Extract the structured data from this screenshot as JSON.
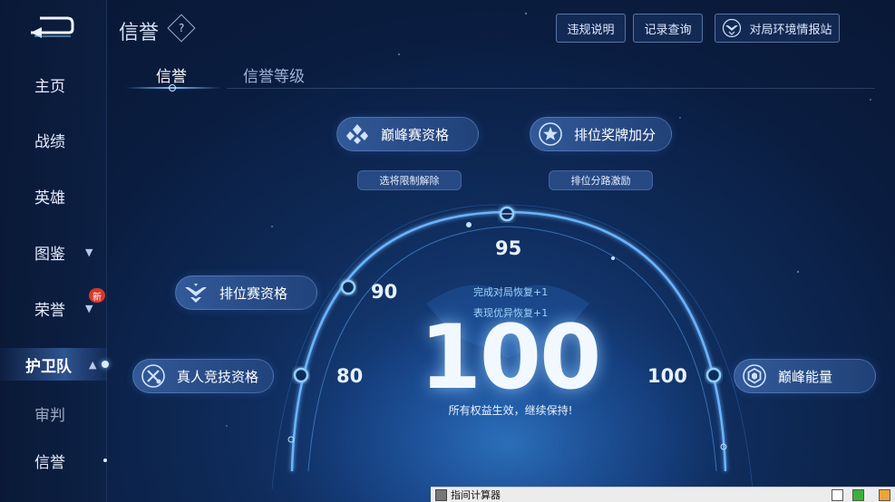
{
  "header": {
    "title": "信誉",
    "help_glyph": "?",
    "buttons": {
      "violation": "违规说明",
      "records": "记录查询",
      "environment": "对局环境情报站"
    }
  },
  "sidebar": {
    "items": [
      {
        "label": "主页"
      },
      {
        "label": "战绩"
      },
      {
        "label": "英雄"
      },
      {
        "label": "图鉴"
      },
      {
        "label": "荣誉",
        "badge": "新"
      },
      {
        "label": "护卫队"
      },
      {
        "label": "审判"
      },
      {
        "label": "信誉"
      }
    ]
  },
  "tabs": [
    {
      "label": "信誉"
    },
    {
      "label": "信誉等级"
    }
  ],
  "privileges": {
    "peak_qualification": "巅峰赛资格",
    "peak_sub": "选将限制解除",
    "ranked_medal": "排位奖牌加分",
    "ranked_medal_sub": "排位分路激励",
    "ranked_qualification": "排位赛资格",
    "real_person": "真人竞技资格",
    "peak_energy": "巅峰能量"
  },
  "thresholds": {
    "t80": "80",
    "t90": "90",
    "t95": "95",
    "t100": "100"
  },
  "score": {
    "value": "100",
    "recover_match": "完成对局恢复+1",
    "recover_excellent": "表现优异恢复+1",
    "status": "所有权益生效，继续保持!"
  },
  "taskbar": {
    "title": "指间计算器"
  },
  "colors": {
    "accent": "#7dc2ff",
    "background": "#0a1d40",
    "badge": "#d8372b"
  }
}
